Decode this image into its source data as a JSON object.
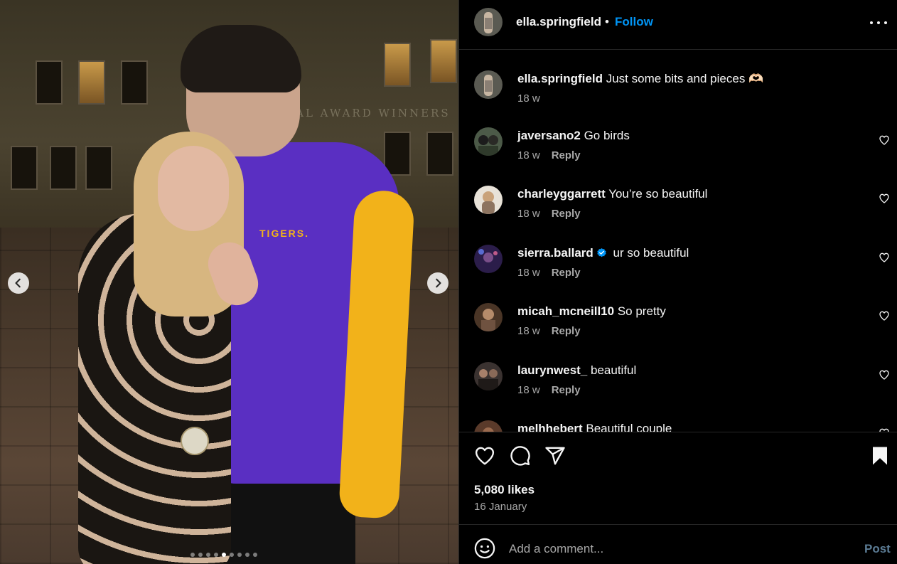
{
  "post": {
    "username": "ella.springfield",
    "follow_label": "Follow",
    "separator": "•",
    "caption_username": "ella.springfield",
    "caption_text": "Just some bits and pieces 🫶🏻",
    "caption_time": "18 w",
    "likes": "5,080 likes",
    "date": "16 January",
    "media_text": "TIGERS.",
    "media_banner": "NAL AWARD WINNERS",
    "carousel": {
      "total": 9,
      "active": 5
    }
  },
  "comments": [
    {
      "username": "javersano2",
      "text": "Go birds",
      "time": "18 w",
      "reply": "Reply",
      "verified": false
    },
    {
      "username": "charleyggarrett",
      "text": "You’re so beautiful",
      "time": "18 w",
      "reply": "Reply",
      "verified": false
    },
    {
      "username": "sierra.ballard",
      "text": "ur so beautiful",
      "time": "18 w",
      "reply": "Reply",
      "verified": true
    },
    {
      "username": "micah_mcneill10",
      "text": "So pretty",
      "time": "18 w",
      "reply": "Reply",
      "verified": false
    },
    {
      "username": "laurynwest_",
      "text": "beautiful",
      "time": "18 w",
      "reply": "Reply",
      "verified": false
    },
    {
      "username": "melhhebert",
      "text": "Beautiful couple",
      "time": "",
      "reply": "",
      "verified": false
    }
  ],
  "composer": {
    "placeholder": "Add a comment...",
    "post_label": "Post"
  },
  "colors": {
    "background": "#000000",
    "link": "#0095f6",
    "muted": "#a8a8a8",
    "verified": "#0095f6",
    "post_disabled": "#5c7c95"
  },
  "icons": {
    "more": "more-options-icon",
    "like": "heart-icon",
    "comment": "comment-icon",
    "share": "share-icon",
    "save": "bookmark-icon",
    "emoji": "emoji-icon",
    "prev": "chevron-left-icon",
    "next": "chevron-right-icon"
  }
}
